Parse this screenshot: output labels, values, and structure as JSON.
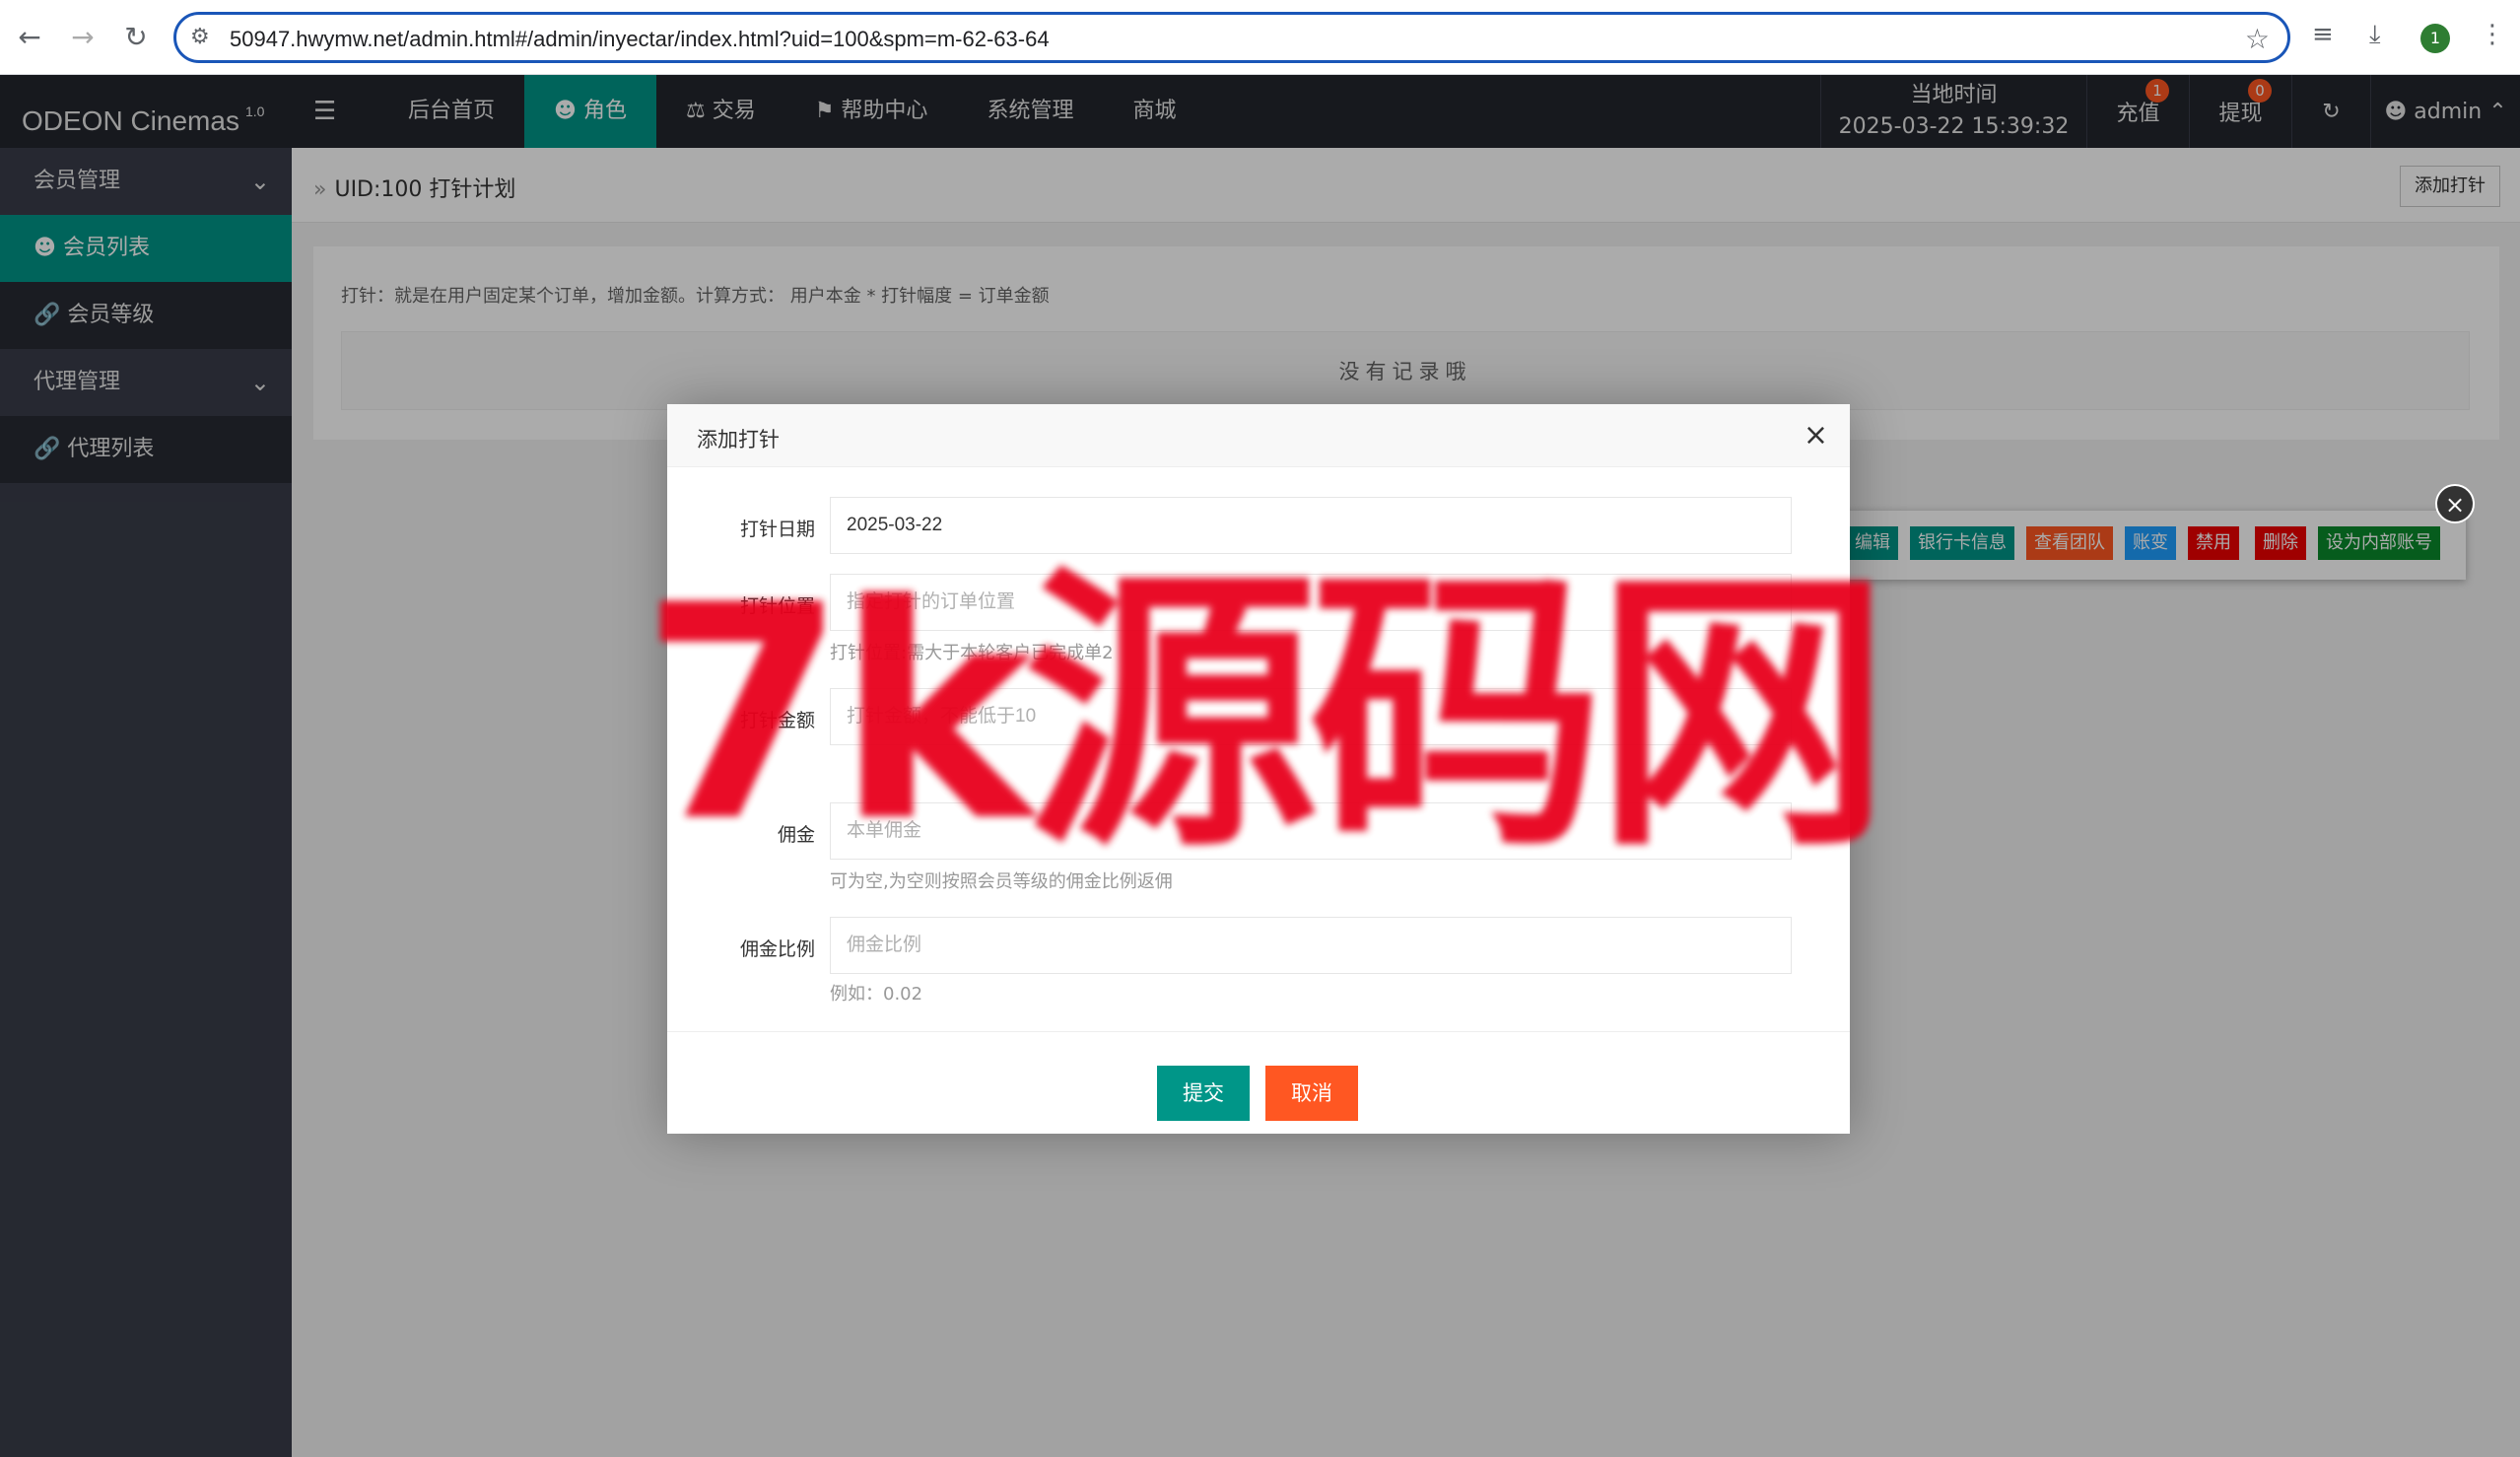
{
  "browser": {
    "url": "50947.hwymw.net/admin.html#/admin/inyectar/index.html?uid=100&spm=m-62-63-64",
    "profile_count": "1"
  },
  "header": {
    "logo": "ODEON Cinemas",
    "logo_version": "1.0",
    "nav": [
      "后台首页",
      "角色",
      "交易",
      "帮助中心",
      "系统管理",
      "商城"
    ],
    "active_nav": "角色",
    "time_label": "当地时间",
    "time_value": "2025-03-22 15:39:32",
    "recharge": "充值",
    "recharge_badge": "1",
    "withdraw": "提现",
    "withdraw_badge": "0",
    "user": "admin"
  },
  "sidebar": {
    "groups": [
      {
        "label": "会员管理",
        "items": [
          "会员列表",
          "会员等级"
        ]
      },
      {
        "label": "代理管理",
        "items": [
          "代理列表"
        ]
      }
    ],
    "active_item": "会员列表"
  },
  "main": {
    "breadcrumb": "UID:100 打针计划",
    "add_button": "添加打针",
    "tip": "打针：就是在用户固定某个订单，增加金额。计算方式： 用户本金 * 打针幅度 = 订单金额",
    "empty_text": "没有记录哦",
    "row_actions": [
      "编辑",
      "银行卡信息",
      "查看团队",
      "账变",
      "禁用",
      "删除",
      "设为内部账号"
    ]
  },
  "modal": {
    "title": "添加打针",
    "fields": [
      {
        "label": "打针日期",
        "value": "2025-03-22",
        "placeholder": "",
        "hint": ""
      },
      {
        "label": "打针位置",
        "value": "",
        "placeholder": "指定打针的订单位置",
        "hint": "打针位置:需大于本轮客户已完成单2"
      },
      {
        "label": "打针金额",
        "value": "",
        "placeholder": "打针金额，不能低于10",
        "hint": ""
      },
      {
        "label": "佣金",
        "value": "",
        "placeholder": "本单佣金",
        "hint": "可为空,为空则按照会员等级的佣金比例返佣"
      },
      {
        "label": "佣金比例",
        "value": "",
        "placeholder": "佣金比例",
        "hint": "例如：0.02"
      }
    ],
    "submit": "提交",
    "cancel": "取消"
  },
  "watermark": "7k源码网",
  "colors": {
    "accent": "#009688",
    "header_bg": "#23262e",
    "sidebar_bg": "#393d49",
    "danger": "#ff5722",
    "watermark": "#e8001c"
  }
}
